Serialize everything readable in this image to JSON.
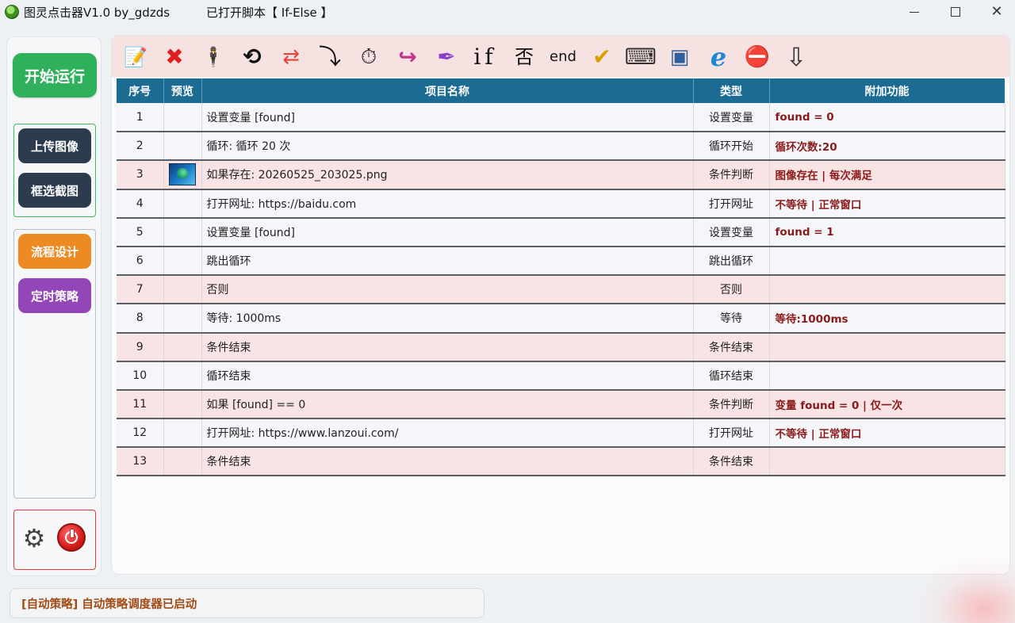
{
  "window": {
    "title": "图灵点击器V1.0 by_gdzds",
    "script_title": "已打开脚本【 If-Else 】",
    "close_glyph": "✕"
  },
  "sidebar": {
    "start_label": "开始运行",
    "upload_label": "上传图像",
    "crop_label": "框选截图",
    "flow_label": "流程设计",
    "timer_label": "定时策略",
    "gear_glyph": "⚙"
  },
  "toolbar": {
    "edit_glyph": "📝",
    "delete_glyph": "✖",
    "agent_glyph": "🕴",
    "loop_glyph": "⟲",
    "shuffle_glyph": "⇄",
    "jump_glyph": "⤵",
    "timer_glyph": "⏱",
    "redo_glyph": "↪",
    "feather_glyph": "✒",
    "if_label": "if",
    "else_label": "否",
    "end_label": "end",
    "check_glyph": "✔",
    "keyboard_glyph": "⌨",
    "window_glyph": "▣",
    "browser_glyph": "ℯ",
    "stop_glyph": "⛔",
    "down_glyph": "⇩"
  },
  "table": {
    "headers": [
      "序号",
      "预览",
      "项目名称",
      "类型",
      "附加功能"
    ],
    "rows": [
      {
        "no": "1",
        "name": "设置变量 [found]",
        "type": "设置变量",
        "extra": "found = 0",
        "pink": false,
        "thumb": false
      },
      {
        "no": "2",
        "name": "循环: 循环 20 次",
        "type": "循环开始",
        "extra": "循环次数:20",
        "pink": false,
        "thumb": false
      },
      {
        "no": "3",
        "name": "如果存在: 20260525_203025.png",
        "type": "条件判断",
        "extra": "图像存在 | 每次满足",
        "pink": true,
        "thumb": true
      },
      {
        "no": "4",
        "name": "打开网址: https://baidu.com",
        "type": "打开网址",
        "extra": "不等待 | 正常窗口",
        "pink": false,
        "thumb": false
      },
      {
        "no": "5",
        "name": "设置变量 [found]",
        "type": "设置变量",
        "extra": "found = 1",
        "pink": false,
        "thumb": false
      },
      {
        "no": "6",
        "name": "跳出循环",
        "type": "跳出循环",
        "extra": "",
        "pink": false,
        "thumb": false
      },
      {
        "no": "7",
        "name": "否则",
        "type": "否则",
        "extra": "",
        "pink": true,
        "thumb": false
      },
      {
        "no": "8",
        "name": "等待: 1000ms",
        "type": "等待",
        "extra": "等待:1000ms",
        "pink": false,
        "thumb": false
      },
      {
        "no": "9",
        "name": "条件结束",
        "type": "条件结束",
        "extra": "",
        "pink": true,
        "thumb": false
      },
      {
        "no": "10",
        "name": "循环结束",
        "type": "循环结束",
        "extra": "",
        "pink": false,
        "thumb": false
      },
      {
        "no": "11",
        "name": "如果 [found] == 0",
        "type": "条件判断",
        "extra": "变量 found = 0 | 仅一次",
        "pink": true,
        "thumb": false
      },
      {
        "no": "12",
        "name": "打开网址: https://www.lanzoui.com/",
        "type": "打开网址",
        "extra": "不等待 | 正常窗口",
        "pink": false,
        "thumb": false
      },
      {
        "no": "13",
        "name": "条件结束",
        "type": "条件结束",
        "extra": "",
        "pink": true,
        "thumb": false
      }
    ]
  },
  "status": {
    "text": "[自动策略] 自动策略调度器已启动"
  }
}
